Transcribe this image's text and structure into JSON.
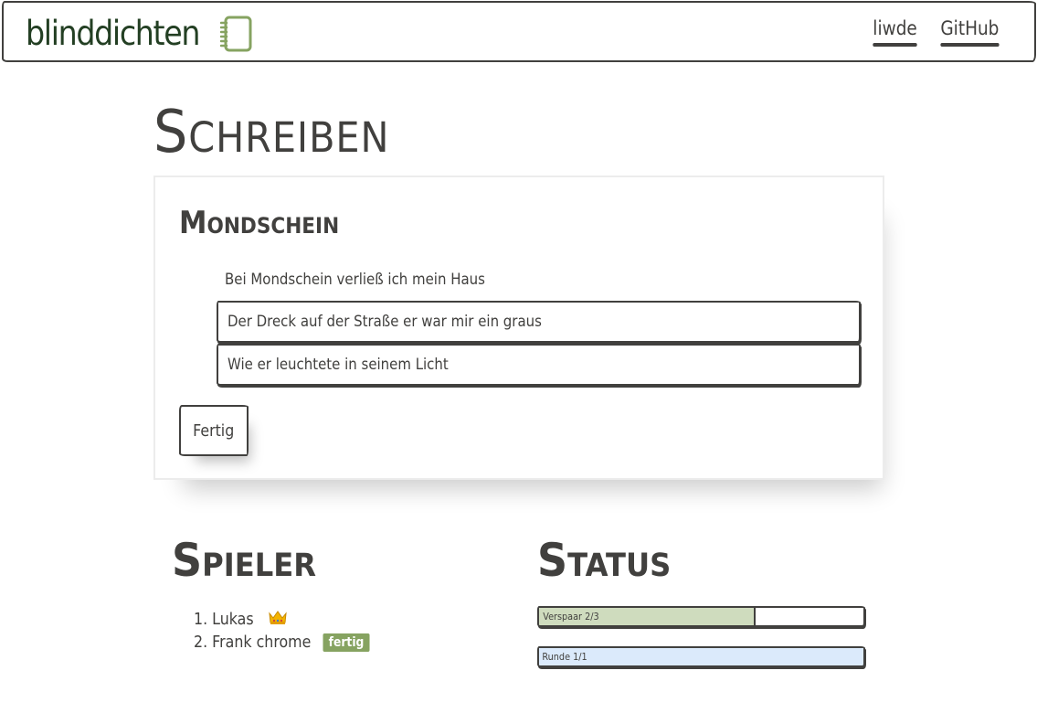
{
  "header": {
    "brand": "blinddichten",
    "brand_icon": "notebook-icon",
    "links": [
      {
        "label": "liwde"
      },
      {
        "label": "GitHub"
      }
    ]
  },
  "write": {
    "title": "Schreiben",
    "poem_title": "Mondschein",
    "given_line": "Bei Mondschein verließ ich mein Haus",
    "line_1_value": "Der Dreck auf der Straße er war mir ein graus",
    "line_2_value": "Wie er leuchtete in seinem Licht",
    "done_label": "Fertig"
  },
  "players": {
    "title": "Spieler",
    "items": [
      {
        "text": "1. Lukas",
        "icon": "crown-icon"
      },
      {
        "text": "2. Frank chrome",
        "badge": "fertig"
      }
    ]
  },
  "status": {
    "title": "Status",
    "verses": {
      "label": "Verspaar 2/3",
      "fraction": 0.667,
      "color": "#cfdcbe"
    },
    "round": {
      "label": "Runde 1/1",
      "fraction": 1.0,
      "color": "#dbeafb"
    }
  },
  "colors": {
    "ink": "#41403e",
    "brand": "#233f23",
    "brand_icon": "#86a361",
    "badge": "#86a361"
  }
}
